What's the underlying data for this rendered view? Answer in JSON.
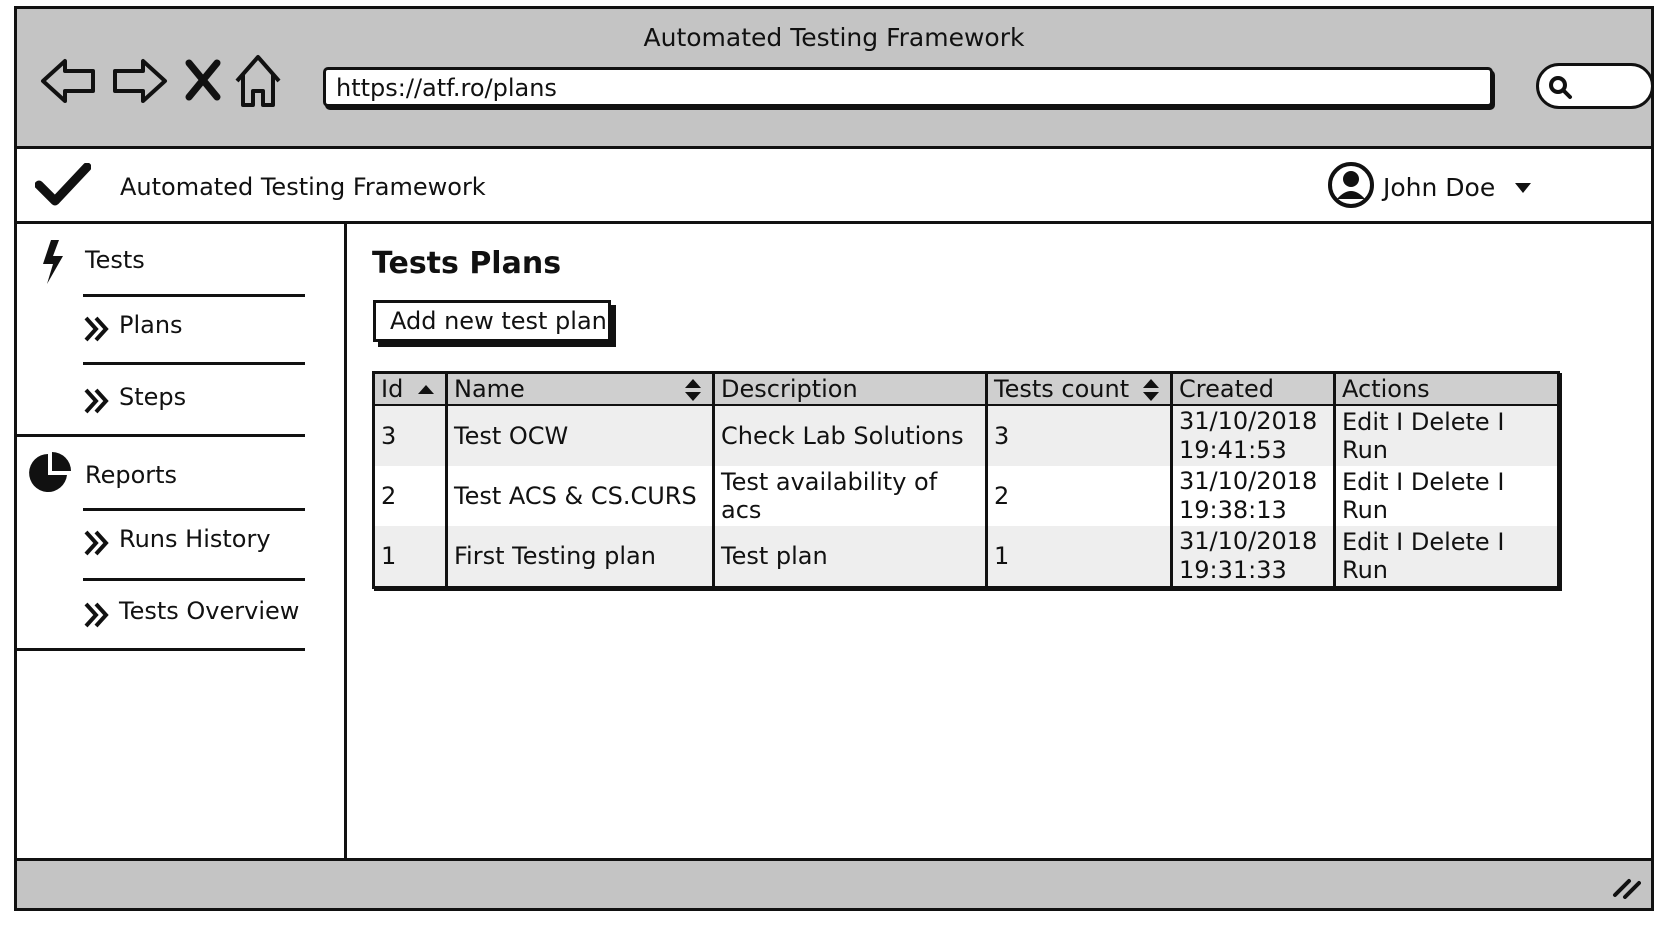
{
  "window": {
    "title": "Automated Testing Framework"
  },
  "browser": {
    "url": "https://atf.ro/plans",
    "icons": [
      "back-arrow-icon",
      "forward-arrow-icon",
      "close-icon",
      "home-icon",
      "search-icon"
    ]
  },
  "header": {
    "app_title": "Automated Testing Framework",
    "logo_icon": "checkmark-icon",
    "user_name": "John Doe"
  },
  "sidebar": {
    "tests_label": "Tests",
    "plans_label": "Plans",
    "steps_label": "Steps",
    "reports_label": "Reports",
    "runs_history_label": "Runs History",
    "tests_overview_label": "Tests Overview"
  },
  "main": {
    "title": "Tests Plans",
    "add_button": "Add new test plan",
    "table": {
      "headers": [
        "Id",
        "Name",
        "Description",
        "Tests count",
        "Created",
        "Actions"
      ],
      "rows": [
        {
          "id": "3",
          "name": "Test OCW",
          "description": "Check Lab Solutions",
          "count": "3",
          "created_date": "31/10/2018",
          "created_time": "19:41:53"
        },
        {
          "id": "2",
          "name": "Test ACS & CS.CURS",
          "description": "Test availability of acs",
          "count": "2",
          "created_date": "31/10/2018",
          "created_time": "19:38:13"
        },
        {
          "id": "1",
          "name": "First Testing plan",
          "description": "Test plan",
          "count": "1",
          "created_date": "31/10/2018",
          "created_time": "19:31:33"
        }
      ],
      "actions": {
        "edit": "Edit",
        "delete": "Delete",
        "run": "Run",
        "separator": "I"
      }
    }
  },
  "colors": {
    "chrome": "#c4c4c4",
    "header_row": "#cfcfcf",
    "odd_row": "#eeeeee",
    "ink": "#111111"
  }
}
